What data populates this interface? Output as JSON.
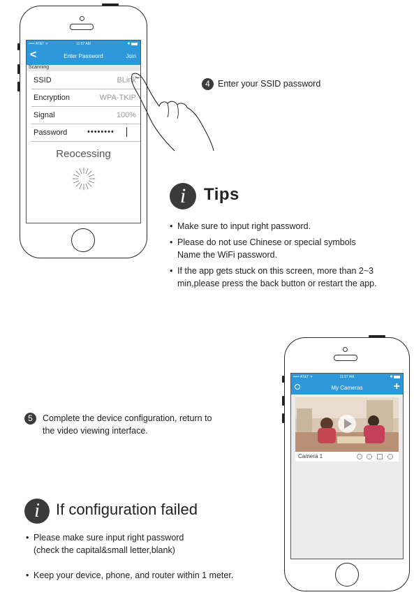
{
  "phone1": {
    "status": {
      "carrier": "••••• AT&T ᯤ",
      "time": "11:57 AM",
      "battery": "✱"
    },
    "nav": {
      "title": "Enter Password",
      "right": "Join",
      "back": "<"
    },
    "section_header": "Scanning",
    "rows": [
      {
        "label": "SSID",
        "value": "BLink"
      },
      {
        "label": "Encryption",
        "value": "WPA-TKIP"
      },
      {
        "label": "Signal",
        "value": "100%"
      },
      {
        "label": "Password",
        "value": "••••••••"
      }
    ],
    "processing_text": "Reocessing"
  },
  "step4": {
    "number": "4",
    "text": "Enter your SSID password"
  },
  "tips": {
    "icon": "i",
    "title": "Tips",
    "items": [
      "Make sure to input right password.",
      "Please do not use Chinese or special symbols",
      "Name the WiFi password.",
      "If the app gets stuck on this screen, more than 2~3",
      "min,please press the back button or restart the app."
    ]
  },
  "step5": {
    "number": "5",
    "line1": "Complete the device configuration, return to",
    "line2": "the video viewing interface."
  },
  "failed": {
    "icon": "i",
    "title": "If configuration failed",
    "items": [
      "Please make sure input right password",
      "(check the capital&small letter,blank)",
      "Keep your device, phone, and router within 1 meter."
    ]
  },
  "phone2": {
    "status": {
      "carrier": "••••• AT&T ᯤ",
      "time": "11:57 AM",
      "battery": "✱"
    },
    "nav": {
      "title": "My Cameras",
      "add": "+"
    },
    "camera_name": "Camera 1"
  },
  "colors": {
    "ios_blue": "#2d97d9",
    "dark_circle": "#3a3a3a"
  }
}
